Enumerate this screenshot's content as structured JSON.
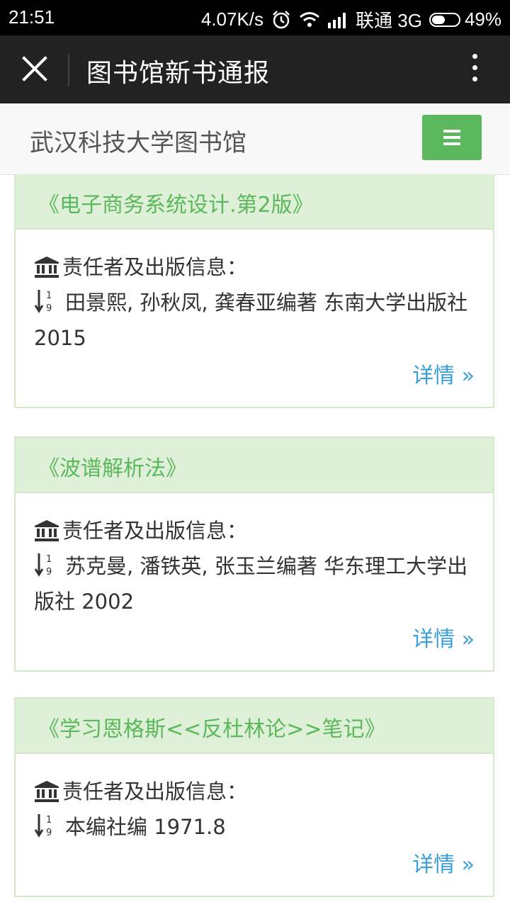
{
  "status_bar": {
    "time": "21:51",
    "speed": "4.07K/s",
    "carrier": "联通 3G",
    "battery": "49%"
  },
  "title_bar": {
    "title": "图书馆新书通报"
  },
  "header": {
    "library_name": "武汉科技大学图书馆"
  },
  "books": [
    {
      "title": "《电子商务系统设计.第2版》",
      "info_label": "责任者及出版信息：",
      "details": "田景熙, 孙秋凤, 龚春亚编著 东南大学出版社 2015",
      "link": "详情 »"
    },
    {
      "title": "《波谱解析法》",
      "info_label": "责任者及出版信息：",
      "details": "苏克曼, 潘铁英, 张玉兰编著 华东理工大学出版社 2002",
      "link": "详情 »"
    },
    {
      "title": "《学习恩格斯<<反杜林论>>笔记》",
      "info_label": "责任者及出版信息：",
      "details": "本编社编 1971.8",
      "link": "详情 »"
    }
  ],
  "colors": {
    "accent_green": "#5cb85c",
    "panel_heading_bg": "#dff0d8",
    "link_blue": "#3a9fd6"
  },
  "icons": [
    "close-icon",
    "more-vert-icon",
    "hamburger-menu-icon",
    "bank-icon",
    "sort-numeric-icon"
  ]
}
